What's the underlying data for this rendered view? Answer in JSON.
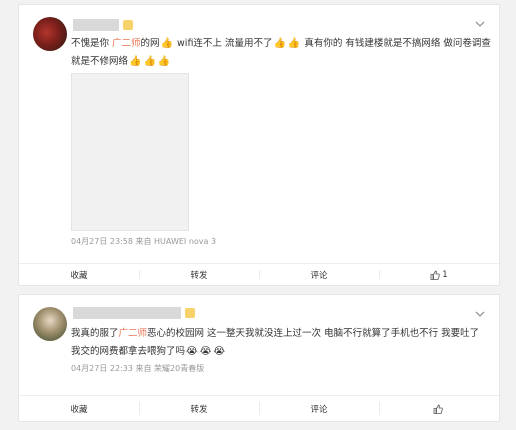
{
  "posts": [
    {
      "text_parts": [
        "不愧是你 ",
        "广二师",
        "的网",
        " wifi连不上 流量用不了",
        " 真有你的 有钱建楼就是不搞网络 做问卷调查就是不修网络"
      ],
      "emoji_names": [
        "thumbs-up",
        "thumbs-up",
        "thumbs-up",
        "thumbs-up",
        "thumbs-up",
        "thumbs-up"
      ],
      "meta": "04月27日 23:58  来自 HUAWEI nova 3",
      "actions": {
        "favorite": "收藏",
        "repost": "转发",
        "comment": "评论",
        "like_count": "1"
      }
    },
    {
      "text_parts": [
        "我真的服了",
        "广二师",
        "恶心的校园网 这一整天我就没连上过一次 电脑不行就算了手机也不行 我要吐了 我交的网费都拿去喂狗了吗"
      ],
      "emoji_names": [
        "crying-face",
        "crying-face",
        "crying-face"
      ],
      "meta": "04月27日 22:33  来自 荣耀20青春版",
      "actions": {
        "favorite": "收藏",
        "repost": "转发",
        "comment": "评论",
        "like_count": ""
      }
    }
  ],
  "colors": {
    "highlight": "#eb7350",
    "meta": "#999999",
    "background": "#f2f2f2"
  }
}
